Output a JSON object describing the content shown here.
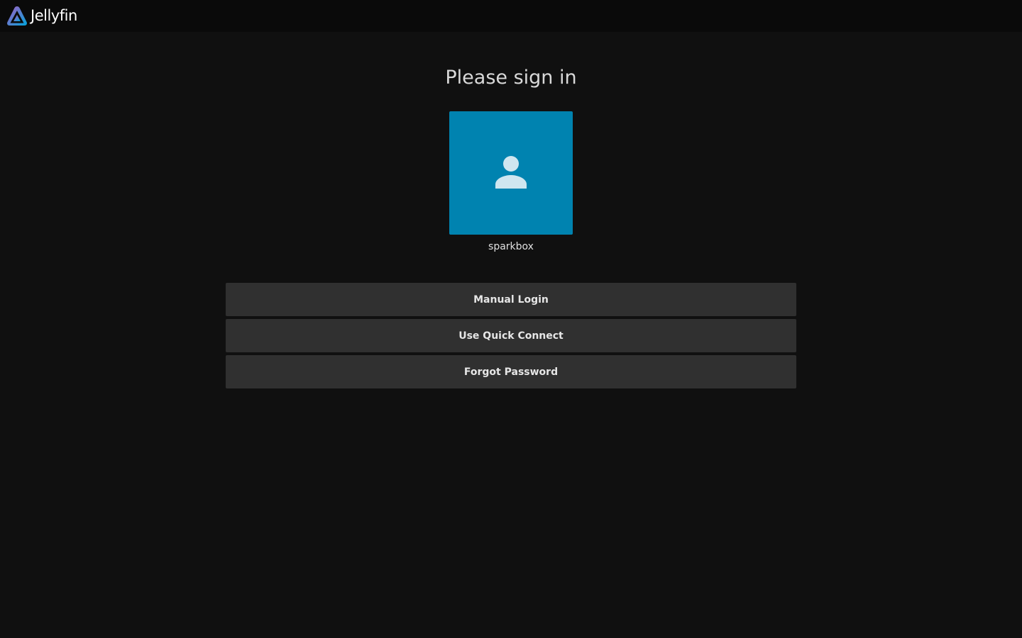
{
  "header": {
    "brand_name": "Jellyfin",
    "logo_icon": "jellyfin-logo-icon"
  },
  "main": {
    "title": "Please sign in",
    "users": [
      {
        "name": "sparkbox",
        "avatar_icon": "person-icon"
      }
    ],
    "buttons": {
      "manual_login": "Manual Login",
      "quick_connect": "Use Quick Connect",
      "forgot_password": "Forgot Password"
    }
  },
  "colors": {
    "background": "#101010",
    "header": "#0a0a0a",
    "avatar": "#0083b0",
    "button": "#303030",
    "logo_gradient_start": "#aa5cc3",
    "logo_gradient_end": "#00a4dc"
  }
}
